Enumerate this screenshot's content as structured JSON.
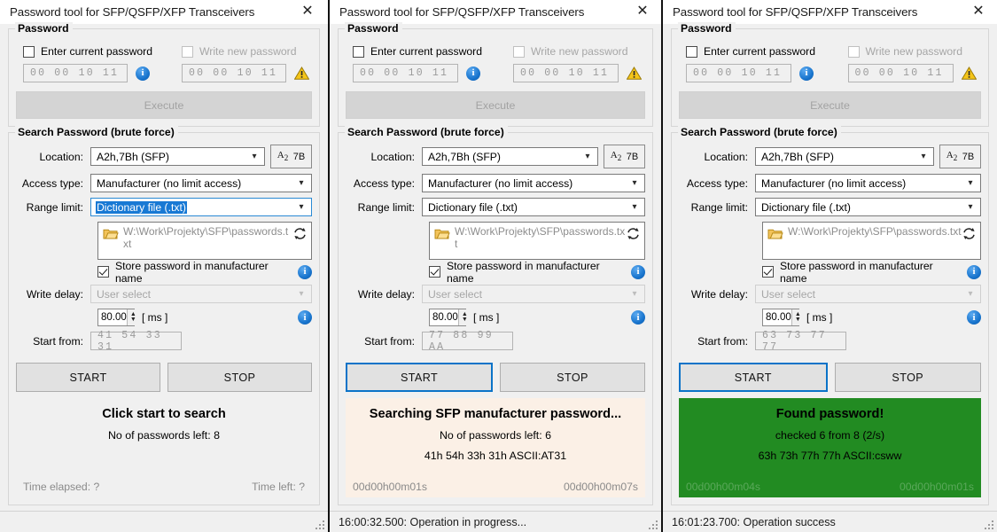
{
  "window": {
    "title": "Password tool for SFP/QSFP/XFP Transceivers",
    "close_icon": "close-icon"
  },
  "password_group": {
    "legend": "Password",
    "enter_current_label": "Enter current password",
    "write_new_label": "Write new password",
    "current_value": "00 00 10 11",
    "new_value": "00 00 10 11",
    "info_icon": "info-icon",
    "warning_icon": "warning-icon",
    "execute_label": "Execute"
  },
  "search_group": {
    "legend": "Search Password (brute force)",
    "location_label": "Location:",
    "location_value": "A2h,7Bh (SFP)",
    "page_a2": "A2",
    "page_7b": "7B",
    "access_label": "Access type:",
    "access_value": "Manufacturer (no limit access)",
    "range_label": "Range limit:",
    "range_value": "Dictionary file (.txt)",
    "file_path": "W:\\Work\\Projekty\\SFP\\passwords.txt",
    "folder_icon": "folder-icon",
    "refresh_icon": "refresh-icon",
    "store_label": "Store password in manufacturer name",
    "write_delay_label": "Write delay:",
    "write_delay_value": "User select",
    "delay_value": "80.00",
    "delay_unit": "[ ms ]",
    "start_from_label": "Start from:",
    "start_button": "START",
    "stop_button": "STOP"
  },
  "panels": [
    {
      "start_from_value": "41 54 33 31",
      "start_focused": false,
      "status_state": "plain",
      "status_title": "Click start to search",
      "status_line1": "No of passwords left: 8",
      "status_line2": "",
      "time_elapsed": "Time elapsed: ?",
      "time_left": "Time left: ?",
      "statusbar_text": ""
    },
    {
      "start_from_value": "77 88 99 AA",
      "start_focused": true,
      "status_state": "busy",
      "status_title": "Searching SFP manufacturer password...",
      "status_line1": "No of passwords left: 6",
      "status_line2": "41h 54h 33h 31h  ASCII:AT31",
      "time_elapsed": "00d00h00m01s",
      "time_left": "00d00h00m07s",
      "statusbar_text": "16:00:32.500: Operation in progress..."
    },
    {
      "start_from_value": "63 73 77 77",
      "start_focused": true,
      "status_state": "ok",
      "status_title": "Found password!",
      "status_line1": "checked 6 from 8 (2/s)",
      "status_line2": "63h 73h 77h 77h  ASCII:csww",
      "time_elapsed": "00d00h00m04s",
      "time_left": "00d00h00m01s",
      "statusbar_text": "16:01:23.700: Operation success"
    }
  ],
  "colors": {
    "window_bg": "#f0f0f0",
    "accent_focus": "#0a73c8",
    "success_green": "#228b22",
    "busy_peach": "#fbf0e6",
    "selection_blue": "#1879d4"
  }
}
